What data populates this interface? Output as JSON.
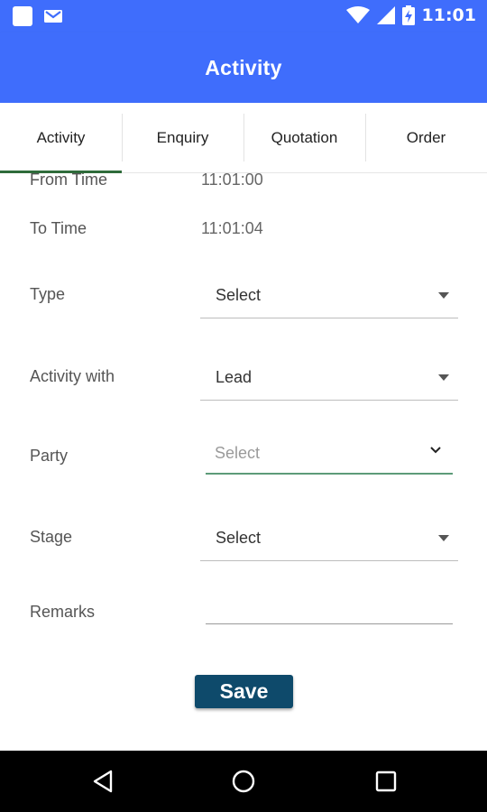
{
  "status_bar": {
    "time": "11:01",
    "icons": [
      "app-square-icon",
      "gmail-icon",
      "wifi-icon",
      "cell-signal-icon",
      "battery-charging-icon"
    ]
  },
  "app_bar": {
    "title": "Activity"
  },
  "tabs": [
    {
      "label": "Activity",
      "active": true
    },
    {
      "label": "Enquiry",
      "active": false
    },
    {
      "label": "Quotation",
      "active": false
    },
    {
      "label": "Order",
      "active": false
    }
  ],
  "form": {
    "from_time": {
      "label": "From Time",
      "value": "11:01:00"
    },
    "to_time": {
      "label": "To Time",
      "value": "11:01:04"
    },
    "type": {
      "label": "Type",
      "value": "Select"
    },
    "activity_with": {
      "label": "Activity with",
      "value": "Lead"
    },
    "party": {
      "label": "Party",
      "placeholder": "Select"
    },
    "stage": {
      "label": "Stage",
      "value": "Select"
    },
    "remarks": {
      "label": "Remarks",
      "value": ""
    }
  },
  "save_label": "Save",
  "colors": {
    "primary": "#3f6dfc",
    "save_button": "#0e4a6b",
    "tab_indicator": "#2e6b3a",
    "focus_underline": "#5d9b79"
  },
  "nav_bar": {
    "icons": [
      "back-icon",
      "home-icon",
      "recents-icon"
    ]
  }
}
